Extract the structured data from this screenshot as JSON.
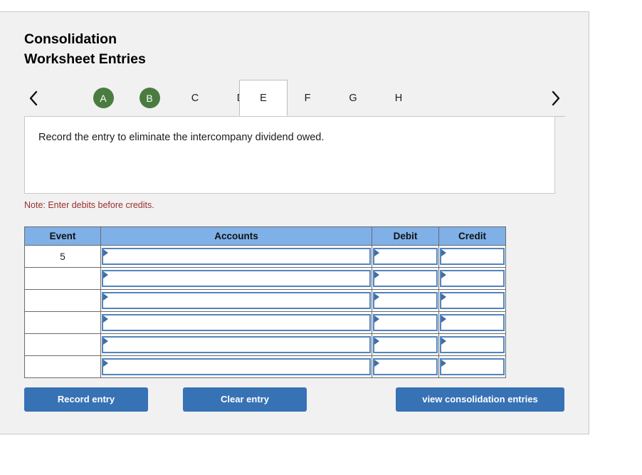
{
  "panel": {
    "title_lines": [
      "Consolidation",
      "Worksheet Entries"
    ]
  },
  "tabs": {
    "prev_label": "‹",
    "next_label": "›",
    "prev_icon": "chevron-left-icon",
    "next_icon": "chevron-right-icon",
    "items": [
      {
        "label": "A",
        "state": "completed"
      },
      {
        "label": "B",
        "state": "completed"
      },
      {
        "label": "C",
        "state": "normal"
      },
      {
        "label": "D",
        "state": "normal"
      },
      {
        "label": "E",
        "state": "selected"
      },
      {
        "label": "F",
        "state": "normal"
      },
      {
        "label": "G",
        "state": "normal"
      },
      {
        "label": "H",
        "state": "normal"
      }
    ],
    "selected": "E"
  },
  "instruction": {
    "text": "Record the entry to eliminate the intercompany dividend owed."
  },
  "note": {
    "text": "Note: Enter debits before credits."
  },
  "journal": {
    "headers": [
      "Event",
      "Accounts",
      "Debit",
      "Credit"
    ],
    "rows": [
      {
        "event": "5",
        "accounts": "",
        "debit": "",
        "credit": ""
      },
      {
        "event": "",
        "accounts": "",
        "debit": "",
        "credit": ""
      },
      {
        "event": "",
        "accounts": "",
        "debit": "",
        "credit": ""
      },
      {
        "event": "",
        "accounts": "",
        "debit": "",
        "credit": ""
      },
      {
        "event": "",
        "accounts": "",
        "debit": "",
        "credit": ""
      },
      {
        "event": "",
        "accounts": "",
        "debit": "",
        "credit": ""
      }
    ]
  },
  "actions": {
    "record_label": "Record entry",
    "clear_label": "Clear entry",
    "view_label": "view consolidation entries"
  },
  "colors": {
    "page_background": "#ffffff",
    "panel_background": "#f1f1f1",
    "panel_border": "#c9c9c9",
    "tab_badge_green": "#4a7c3f",
    "table_header_blue": "#7fb0e8",
    "table_border_gray": "#6b6b6b",
    "control_border_blue": "#5184bd",
    "control_triangle_blue": "#3f6ea8",
    "button_blue": "#3772b5",
    "note_red": "#9b2f2f",
    "text_dark": "#1b1b1b"
  }
}
